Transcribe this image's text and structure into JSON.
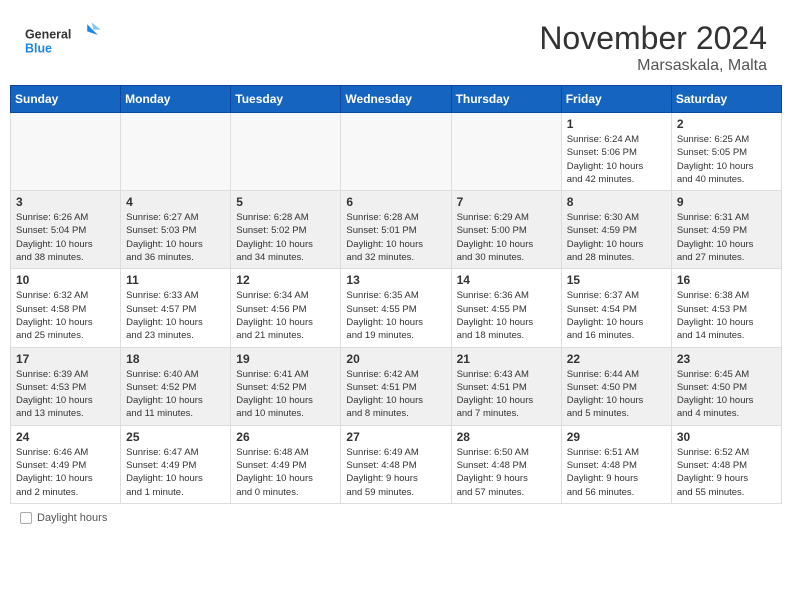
{
  "header": {
    "logo_general": "General",
    "logo_blue": "Blue",
    "month_title": "November 2024",
    "location": "Marsaskala, Malta"
  },
  "weekdays": [
    "Sunday",
    "Monday",
    "Tuesday",
    "Wednesday",
    "Thursday",
    "Friday",
    "Saturday"
  ],
  "days": [
    {
      "date": "",
      "info": ""
    },
    {
      "date": "",
      "info": ""
    },
    {
      "date": "",
      "info": ""
    },
    {
      "date": "",
      "info": ""
    },
    {
      "date": "",
      "info": ""
    },
    {
      "date": "1",
      "info": "Sunrise: 6:24 AM\nSunset: 5:06 PM\nDaylight: 10 hours\nand 42 minutes."
    },
    {
      "date": "2",
      "info": "Sunrise: 6:25 AM\nSunset: 5:05 PM\nDaylight: 10 hours\nand 40 minutes."
    },
    {
      "date": "3",
      "info": "Sunrise: 6:26 AM\nSunset: 5:04 PM\nDaylight: 10 hours\nand 38 minutes."
    },
    {
      "date": "4",
      "info": "Sunrise: 6:27 AM\nSunset: 5:03 PM\nDaylight: 10 hours\nand 36 minutes."
    },
    {
      "date": "5",
      "info": "Sunrise: 6:28 AM\nSunset: 5:02 PM\nDaylight: 10 hours\nand 34 minutes."
    },
    {
      "date": "6",
      "info": "Sunrise: 6:28 AM\nSunset: 5:01 PM\nDaylight: 10 hours\nand 32 minutes."
    },
    {
      "date": "7",
      "info": "Sunrise: 6:29 AM\nSunset: 5:00 PM\nDaylight: 10 hours\nand 30 minutes."
    },
    {
      "date": "8",
      "info": "Sunrise: 6:30 AM\nSunset: 4:59 PM\nDaylight: 10 hours\nand 28 minutes."
    },
    {
      "date": "9",
      "info": "Sunrise: 6:31 AM\nSunset: 4:59 PM\nDaylight: 10 hours\nand 27 minutes."
    },
    {
      "date": "10",
      "info": "Sunrise: 6:32 AM\nSunset: 4:58 PM\nDaylight: 10 hours\nand 25 minutes."
    },
    {
      "date": "11",
      "info": "Sunrise: 6:33 AM\nSunset: 4:57 PM\nDaylight: 10 hours\nand 23 minutes."
    },
    {
      "date": "12",
      "info": "Sunrise: 6:34 AM\nSunset: 4:56 PM\nDaylight: 10 hours\nand 21 minutes."
    },
    {
      "date": "13",
      "info": "Sunrise: 6:35 AM\nSunset: 4:55 PM\nDaylight: 10 hours\nand 19 minutes."
    },
    {
      "date": "14",
      "info": "Sunrise: 6:36 AM\nSunset: 4:55 PM\nDaylight: 10 hours\nand 18 minutes."
    },
    {
      "date": "15",
      "info": "Sunrise: 6:37 AM\nSunset: 4:54 PM\nDaylight: 10 hours\nand 16 minutes."
    },
    {
      "date": "16",
      "info": "Sunrise: 6:38 AM\nSunset: 4:53 PM\nDaylight: 10 hours\nand 14 minutes."
    },
    {
      "date": "17",
      "info": "Sunrise: 6:39 AM\nSunset: 4:53 PM\nDaylight: 10 hours\nand 13 minutes."
    },
    {
      "date": "18",
      "info": "Sunrise: 6:40 AM\nSunset: 4:52 PM\nDaylight: 10 hours\nand 11 minutes."
    },
    {
      "date": "19",
      "info": "Sunrise: 6:41 AM\nSunset: 4:52 PM\nDaylight: 10 hours\nand 10 minutes."
    },
    {
      "date": "20",
      "info": "Sunrise: 6:42 AM\nSunset: 4:51 PM\nDaylight: 10 hours\nand 8 minutes."
    },
    {
      "date": "21",
      "info": "Sunrise: 6:43 AM\nSunset: 4:51 PM\nDaylight: 10 hours\nand 7 minutes."
    },
    {
      "date": "22",
      "info": "Sunrise: 6:44 AM\nSunset: 4:50 PM\nDaylight: 10 hours\nand 5 minutes."
    },
    {
      "date": "23",
      "info": "Sunrise: 6:45 AM\nSunset: 4:50 PM\nDaylight: 10 hours\nand 4 minutes."
    },
    {
      "date": "24",
      "info": "Sunrise: 6:46 AM\nSunset: 4:49 PM\nDaylight: 10 hours\nand 2 minutes."
    },
    {
      "date": "25",
      "info": "Sunrise: 6:47 AM\nSunset: 4:49 PM\nDaylight: 10 hours\nand 1 minute."
    },
    {
      "date": "26",
      "info": "Sunrise: 6:48 AM\nSunset: 4:49 PM\nDaylight: 10 hours\nand 0 minutes."
    },
    {
      "date": "27",
      "info": "Sunrise: 6:49 AM\nSunset: 4:48 PM\nDaylight: 9 hours\nand 59 minutes."
    },
    {
      "date": "28",
      "info": "Sunrise: 6:50 AM\nSunset: 4:48 PM\nDaylight: 9 hours\nand 57 minutes."
    },
    {
      "date": "29",
      "info": "Sunrise: 6:51 AM\nSunset: 4:48 PM\nDaylight: 9 hours\nand 56 minutes."
    },
    {
      "date": "30",
      "info": "Sunrise: 6:52 AM\nSunset: 4:48 PM\nDaylight: 9 hours\nand 55 minutes."
    }
  ],
  "legend": {
    "daylight_label": "Daylight hours"
  }
}
